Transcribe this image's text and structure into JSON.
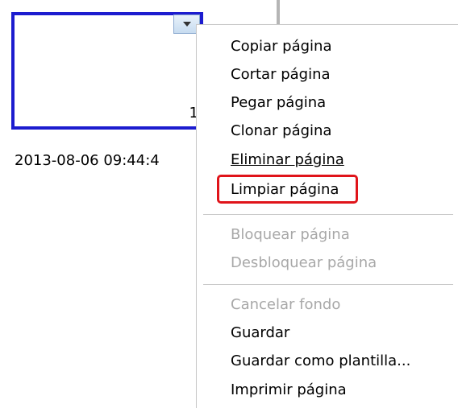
{
  "thumbnail": {
    "page_number": "1"
  },
  "timestamp": "2013-08-06 09:44:4",
  "menu": {
    "items": [
      {
        "label": "Copiar página",
        "enabled": true
      },
      {
        "label": "Cortar página",
        "enabled": true
      },
      {
        "label": "Pegar página",
        "enabled": true
      },
      {
        "label": "Clonar página",
        "enabled": true
      },
      {
        "label": "Eliminar página",
        "enabled": true
      },
      {
        "label": "Limpiar página",
        "enabled": true,
        "highlighted": true
      },
      {
        "label": "Bloquear página",
        "enabled": false
      },
      {
        "label": "Desbloquear página",
        "enabled": false
      },
      {
        "label": "Cancelar fondo",
        "enabled": false
      },
      {
        "label": "Guardar",
        "enabled": true
      },
      {
        "label": "Guardar como plantilla...",
        "enabled": true
      },
      {
        "label": "Imprimir página",
        "enabled": true
      }
    ]
  },
  "colors": {
    "thumbnail_border": "#1c1ccf",
    "highlight_border": "#e0141a",
    "disabled_text": "#a8a8a8"
  }
}
